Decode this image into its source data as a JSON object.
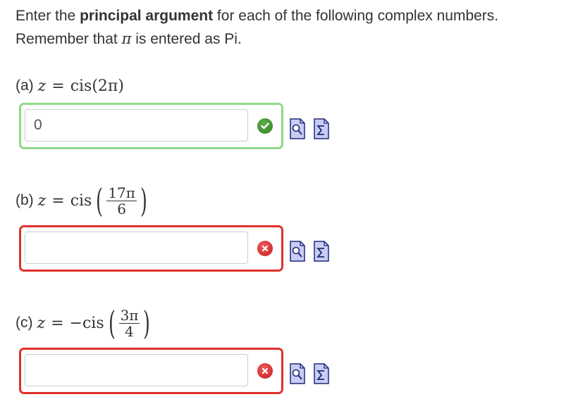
{
  "instructions": {
    "line1_prefix": "Enter the ",
    "line1_bold": "principal argument",
    "line1_suffix": " for each of the following complex numbers.",
    "line2_prefix": "Remember that ",
    "line2_pi": "π",
    "line2_suffix": " is entered as Pi."
  },
  "questions": [
    {
      "tag": "(a)",
      "z": "z",
      "eq": "=",
      "func": "cis(2π)",
      "answer_value": "0",
      "status": "correct"
    },
    {
      "tag": "(b)",
      "z": "z",
      "eq": "=",
      "func": "cis",
      "numerator": "17π",
      "denominator": "6",
      "answer_value": "",
      "status": "incorrect"
    },
    {
      "tag": "(c)",
      "z": "z",
      "eq": "=",
      "func": "−cis",
      "numerator": "3π",
      "denominator": "4",
      "answer_value": "",
      "status": "incorrect"
    }
  ],
  "icons": {
    "correct": "check-circle-icon",
    "incorrect": "x-circle-icon",
    "preview": "magnifier-preview-icon",
    "equation": "sigma-equation-editor-icon"
  },
  "colors": {
    "correct_border": "#8fd98a",
    "incorrect_border": "#e0322b",
    "correct_icon": "#3d8f2f",
    "incorrect_icon": "#d02525",
    "tool_icon_fill": "#c9cdf3"
  }
}
